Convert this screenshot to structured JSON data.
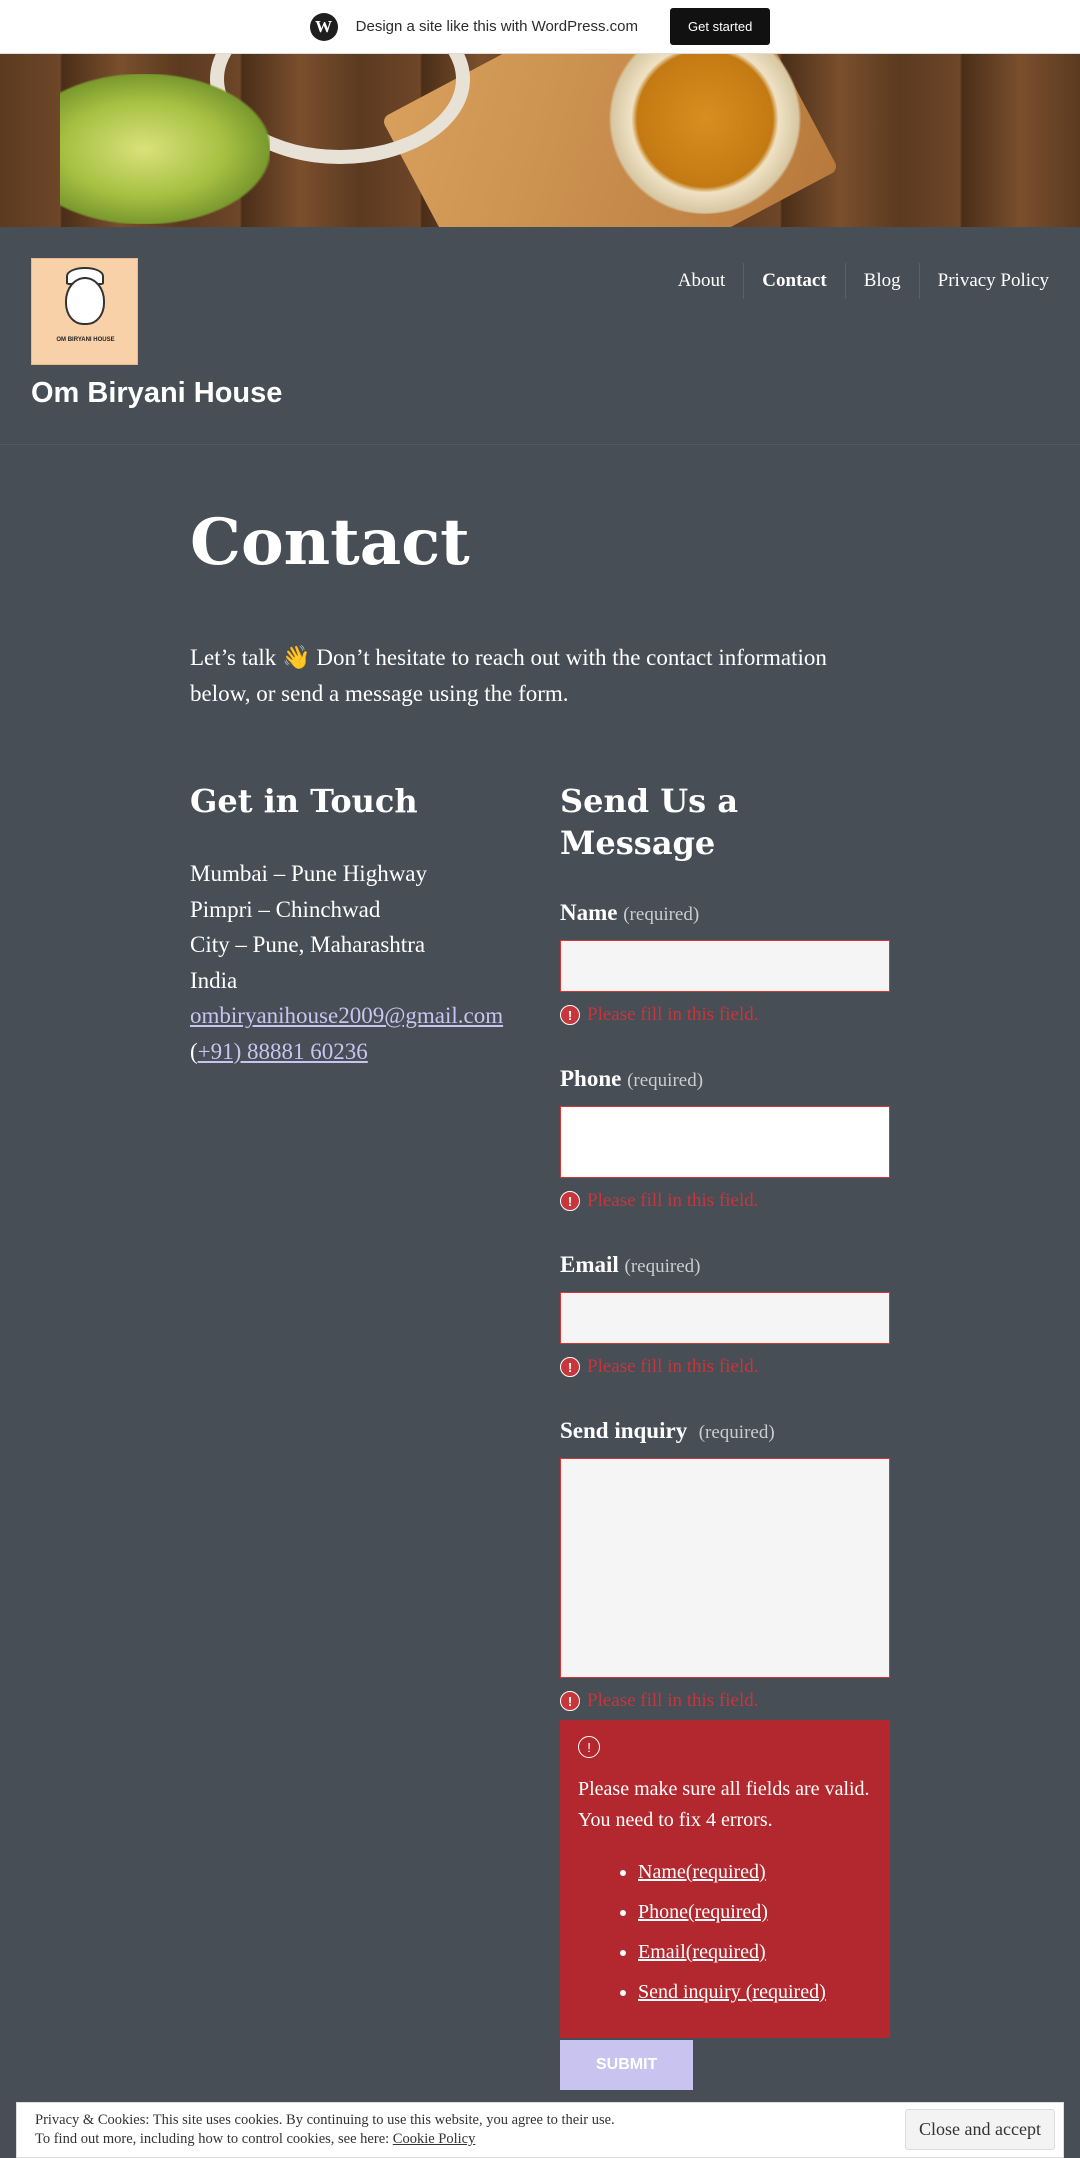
{
  "wpbar": {
    "text": "Design a site like this with WordPress.com",
    "button": "Get started",
    "logo_glyph": "W"
  },
  "header": {
    "logo_text": "OM BIRYANI HOUSE",
    "site_title": "Om Biryani House",
    "nav": [
      {
        "label": "About",
        "active": false
      },
      {
        "label": "Contact",
        "active": true
      },
      {
        "label": "Blog",
        "active": false
      },
      {
        "label": "Privacy Policy",
        "active": false
      }
    ]
  },
  "page": {
    "title": "Contact",
    "intro": "Let’s talk 👋 Don’t hesitate to reach out with the contact information below, or send a message using the form."
  },
  "contact": {
    "heading": "Get in Touch",
    "address": [
      "Mumbai – Pune Highway",
      "Pimpri – Chinchwad",
      "City – Pune, Maharashtra",
      "India"
    ],
    "email": "ombiryanihouse2009@gmail.com",
    "phone_prefix": "(",
    "phone": "+91) 88881 60236"
  },
  "form": {
    "heading": "Send Us a Message",
    "required_text": "(required)",
    "error_text": "Please fill in this field.",
    "fields": {
      "name": "Name",
      "phone": "Phone",
      "email": "Email",
      "inquiry": "Send inquiry"
    },
    "summary": {
      "icon": "!",
      "message": "Please make sure all fields are valid. You need to fix 4 errors.",
      "items": [
        "Name(required)",
        "Phone(required)",
        "Email(required)",
        "Send inquiry (required)"
      ]
    },
    "submit": "SUBMIT"
  },
  "cookie": {
    "line1": "Privacy & Cookies: This site uses cookies. By continuing to use this website, you agree to their use.",
    "line2": "To find out more, including how to control cookies, see here:",
    "link": "Cookie Policy",
    "button": "Close and accept"
  },
  "colors": {
    "background": "#474e56",
    "error": "#b2282e",
    "accent": "#c8c4f0",
    "submit": "#c9c3ef"
  }
}
